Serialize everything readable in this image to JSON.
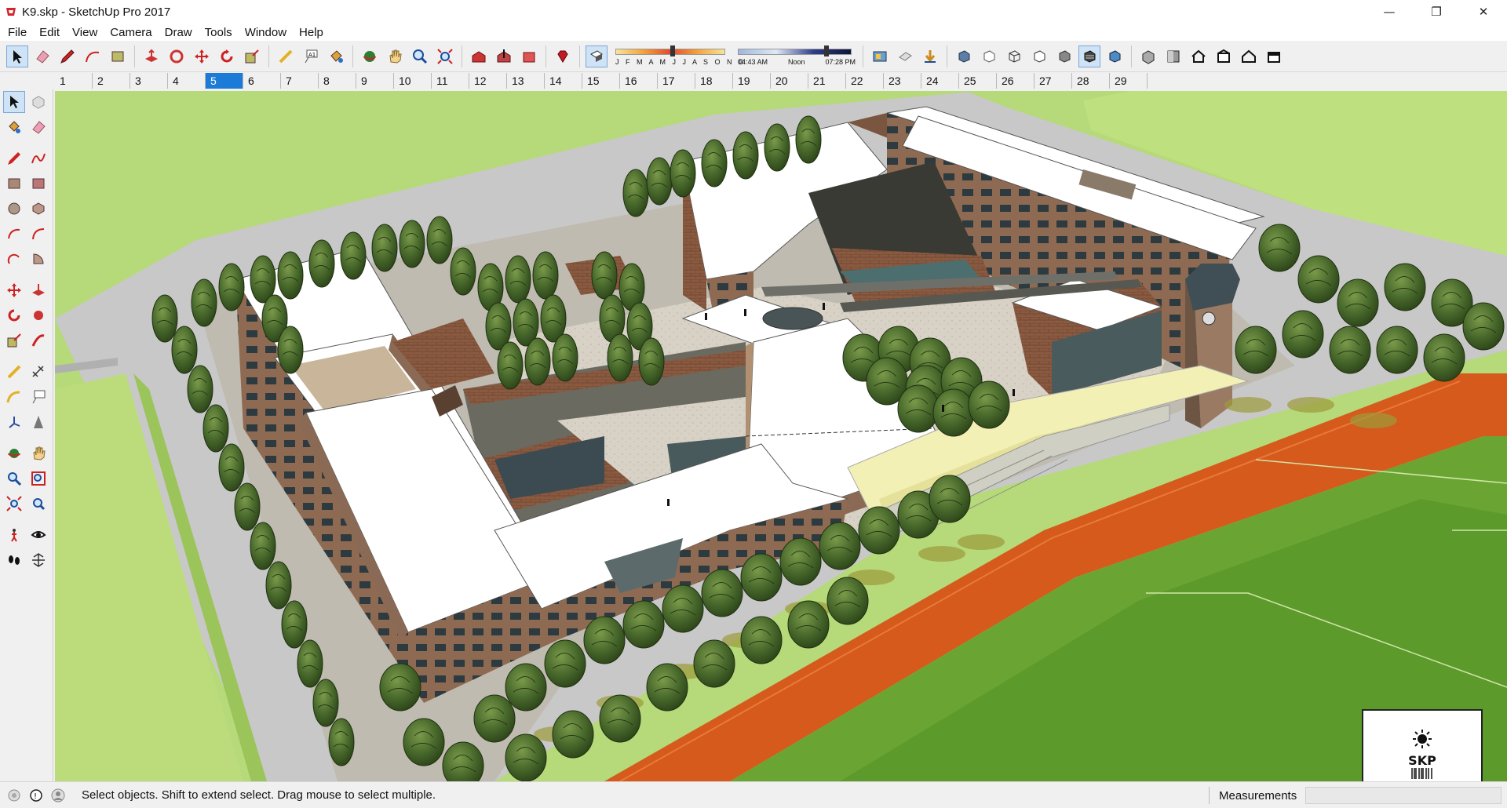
{
  "window": {
    "title": "K9.skp - SketchUp Pro 2017"
  },
  "menu": [
    "File",
    "Edit",
    "View",
    "Camera",
    "Draw",
    "Tools",
    "Window",
    "Help"
  ],
  "shadow": {
    "months": "J F M A M J J A S O N D",
    "time_start": "04:43 AM",
    "time_mid": "Noon",
    "time_end": "07:28 PM"
  },
  "scenes": {
    "tabs": [
      "1",
      "2",
      "3",
      "4",
      "5",
      "6",
      "7",
      "8",
      "9",
      "10",
      "11",
      "12",
      "13",
      "14",
      "15",
      "16",
      "17",
      "18",
      "19",
      "20",
      "21",
      "22",
      "23",
      "24",
      "25",
      "26",
      "27",
      "28",
      "29"
    ],
    "active": "5"
  },
  "status": {
    "message": "Select objects. Shift to extend select. Drag mouse to select multiple.",
    "measurements_label": "Measurements",
    "measurements_value": ""
  },
  "logo": {
    "text": "SKP"
  },
  "colors": {
    "grass": "#b6d97a",
    "field": "#5c9a2c",
    "track": "#d55a1c",
    "roof": "#ffffff",
    "brick": "#8a5a40",
    "tree": "#3d5a1e",
    "accent": "#1c7bd6"
  }
}
